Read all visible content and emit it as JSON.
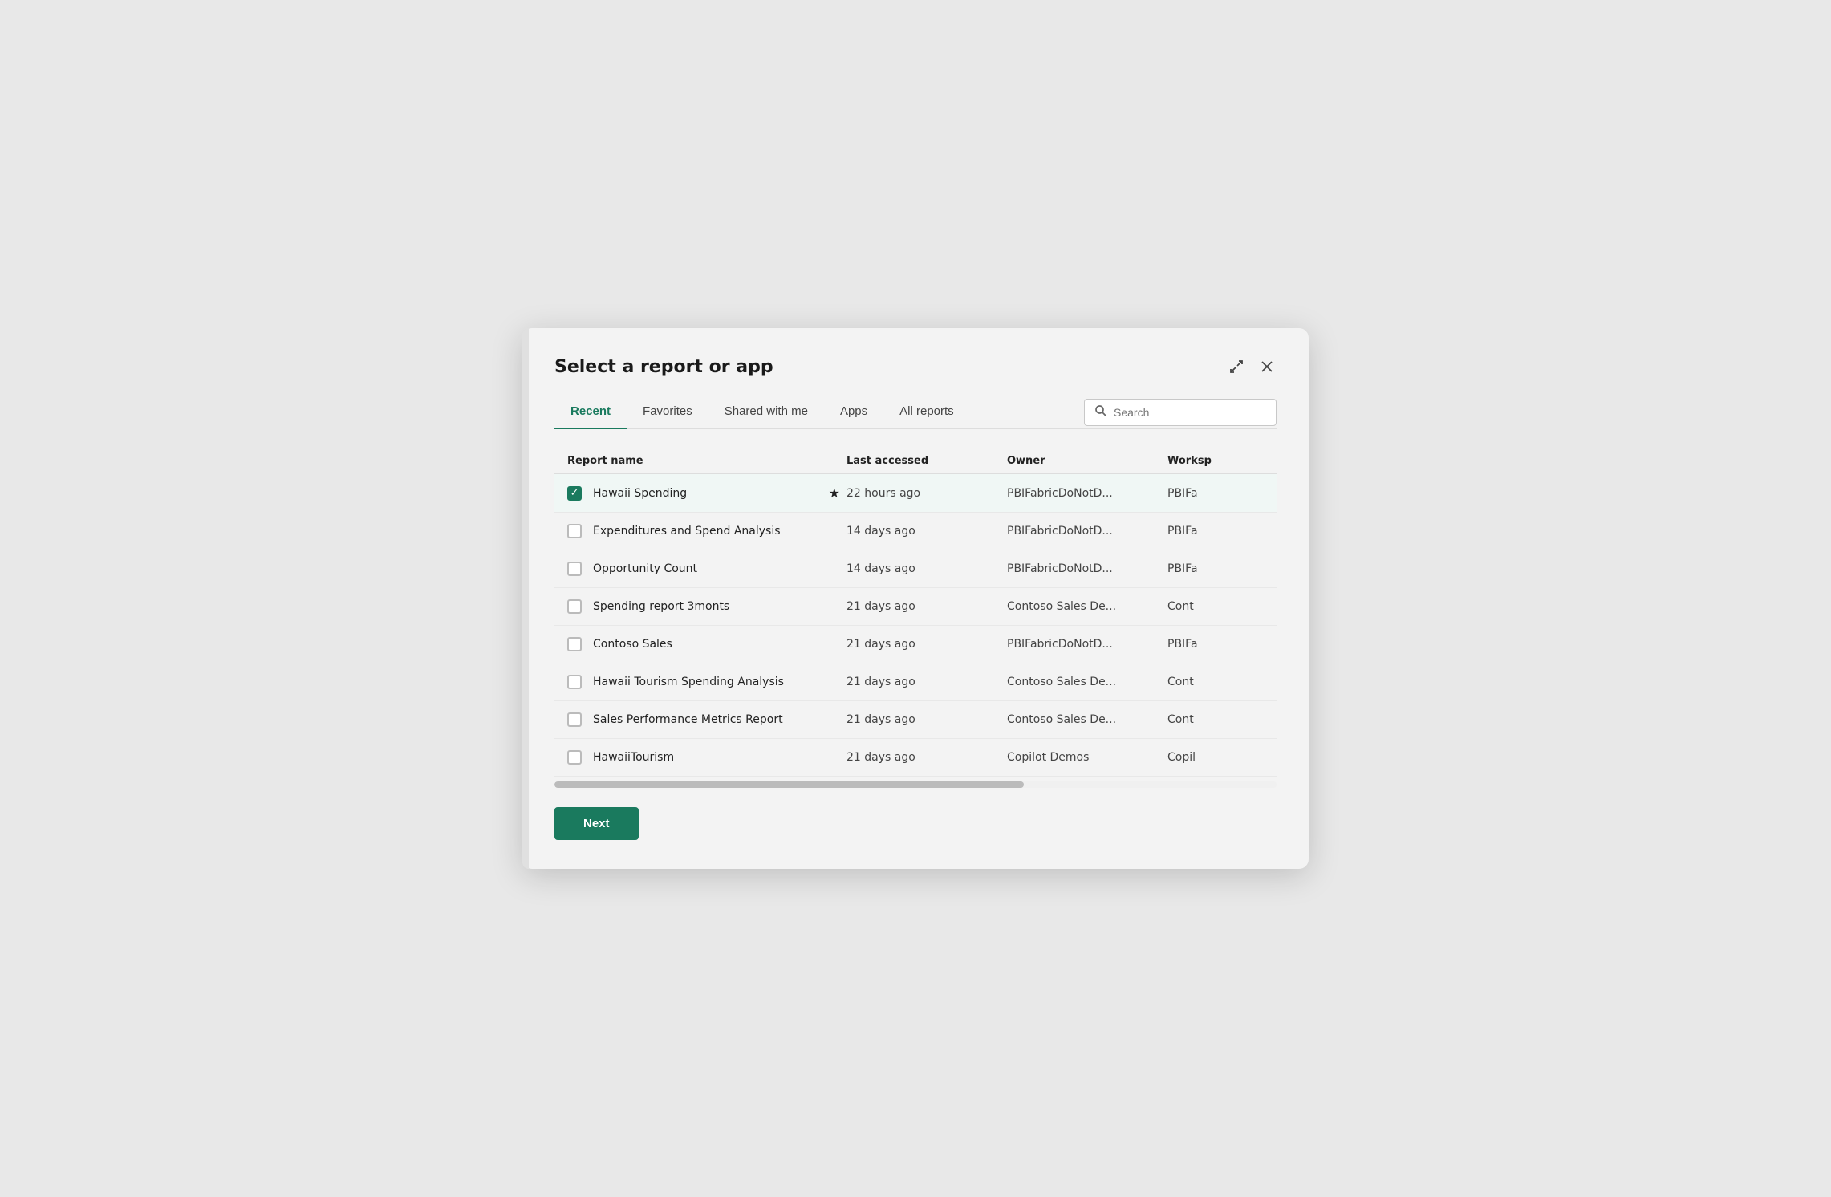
{
  "modal": {
    "title": "Select a report or app"
  },
  "tabs": [
    {
      "id": "recent",
      "label": "Recent",
      "active": true
    },
    {
      "id": "favorites",
      "label": "Favorites",
      "active": false
    },
    {
      "id": "shared",
      "label": "Shared with me",
      "active": false
    },
    {
      "id": "apps",
      "label": "Apps",
      "active": false
    },
    {
      "id": "allreports",
      "label": "All reports",
      "active": false
    }
  ],
  "search": {
    "placeholder": "Search"
  },
  "columns": {
    "name": "Report name",
    "lastAccessed": "Last accessed",
    "owner": "Owner",
    "workspace": "Worksp"
  },
  "rows": [
    {
      "id": 1,
      "name": "Hawaii Spending",
      "lastAccessed": "22 hours ago",
      "owner": "PBIFabricDoNotD...",
      "workspace": "PBIFa",
      "selected": true,
      "starred": true
    },
    {
      "id": 2,
      "name": "Expenditures and Spend Analysis",
      "lastAccessed": "14 days ago",
      "owner": "PBIFabricDoNotD...",
      "workspace": "PBIFa",
      "selected": false,
      "starred": false
    },
    {
      "id": 3,
      "name": "Opportunity Count",
      "lastAccessed": "14 days ago",
      "owner": "PBIFabricDoNotD...",
      "workspace": "PBIFa",
      "selected": false,
      "starred": false
    },
    {
      "id": 4,
      "name": "Spending report 3monts",
      "lastAccessed": "21 days ago",
      "owner": "Contoso Sales De...",
      "workspace": "Cont",
      "selected": false,
      "starred": false
    },
    {
      "id": 5,
      "name": "Contoso Sales",
      "lastAccessed": "21 days ago",
      "owner": "PBIFabricDoNotD...",
      "workspace": "PBIFa",
      "selected": false,
      "starred": false
    },
    {
      "id": 6,
      "name": "Hawaii Tourism Spending Analysis",
      "lastAccessed": "21 days ago",
      "owner": "Contoso Sales De...",
      "workspace": "Cont",
      "selected": false,
      "starred": false
    },
    {
      "id": 7,
      "name": "Sales Performance Metrics Report",
      "lastAccessed": "21 days ago",
      "owner": "Contoso Sales De...",
      "workspace": "Cont",
      "selected": false,
      "starred": false
    },
    {
      "id": 8,
      "name": "HawaiiTourism",
      "lastAccessed": "21 days ago",
      "owner": "Copilot Demos",
      "workspace": "Copil",
      "selected": false,
      "starred": false
    }
  ],
  "buttons": {
    "next": "Next",
    "expand": "⤢",
    "close": "✕"
  }
}
